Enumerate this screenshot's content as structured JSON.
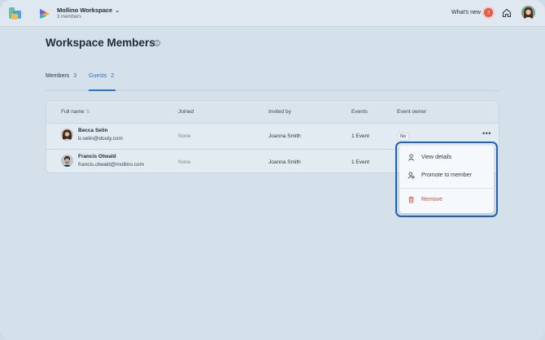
{
  "header": {
    "workspace_name": "Mollino Workspace",
    "workspace_members": "3 members",
    "whats_new_label": "What's new",
    "whats_new_count": "3"
  },
  "page": {
    "title": "Workspace Members"
  },
  "tabs": [
    {
      "label": "Members",
      "count": "3",
      "active": false
    },
    {
      "label": "Guests",
      "count": "2",
      "active": true
    }
  ],
  "table": {
    "columns": [
      "Full name",
      "Joined",
      "Invited by",
      "Events",
      "Event owner"
    ],
    "rows": [
      {
        "name": "Becca Selin",
        "email": "b.selin@douty.com",
        "joined": "None",
        "invited_by": "Joanna Smith",
        "events": "1 Event",
        "event_owner": "No"
      },
      {
        "name": "Francis Otwald",
        "email": "francis.otwald@mollino.com",
        "joined": "None",
        "invited_by": "Joanna Smith",
        "events": "1 Event",
        "event_owner": ""
      }
    ]
  },
  "menu": {
    "items": [
      {
        "label": "View details",
        "icon": "person-icon"
      },
      {
        "label": "Promote to member",
        "icon": "person-gear-icon"
      },
      {
        "label": "Remove",
        "icon": "trash-icon"
      }
    ]
  },
  "colors": {
    "accent": "#2b74c0",
    "danger": "#d5493c",
    "badge": "#e25c4a"
  }
}
